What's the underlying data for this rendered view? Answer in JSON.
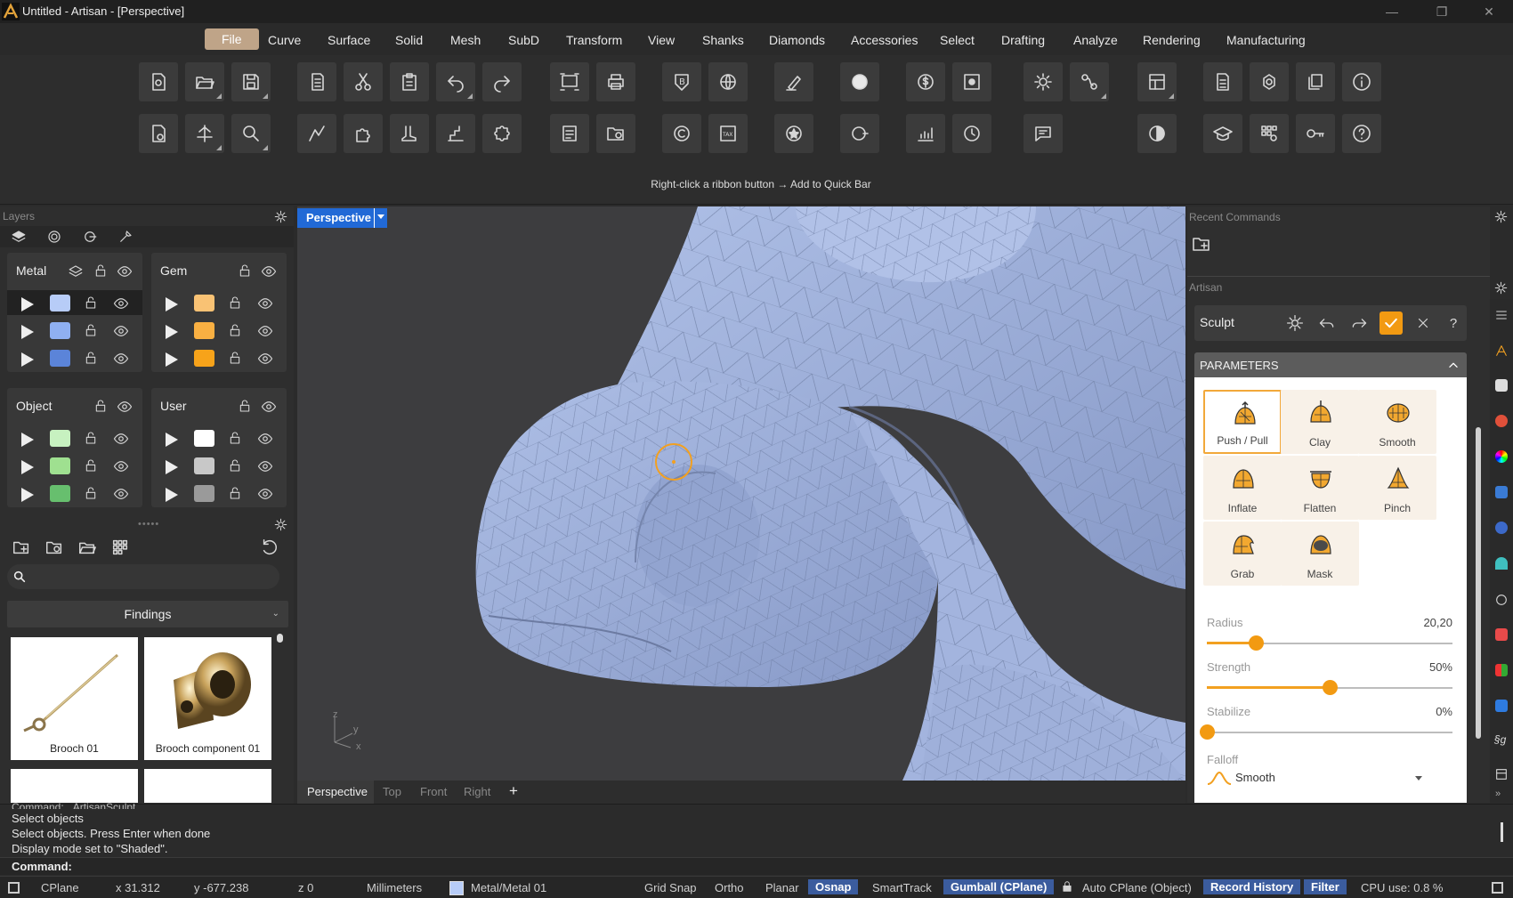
{
  "window": {
    "title": "Untitled - Artisan - [Perspective]",
    "controls": [
      "—",
      "❐",
      "✕"
    ]
  },
  "menu": [
    "File",
    "Curve",
    "Surface",
    "Solid",
    "Mesh",
    "SubD",
    "Transform",
    "View",
    "Shanks",
    "Diamonds",
    "Accessories",
    "Select",
    "Drafting",
    "Analyze",
    "Rendering",
    "Manufacturing"
  ],
  "ribbon": {
    "hint": "Right-click a ribbon button → Add to Quick Bar"
  },
  "layers": {
    "title": "Layers",
    "groups": [
      {
        "name": "Metal",
        "colors": [
          "#b7ccf7",
          "#8fb0f2",
          "#5b84d9"
        ]
      },
      {
        "name": "Gem",
        "colors": [
          "#f9c274",
          "#f9b042",
          "#f7a31a"
        ]
      },
      {
        "name": "Object",
        "colors": [
          "#c7f1c0",
          "#9fe090",
          "#67bf6e"
        ]
      },
      {
        "name": "User",
        "colors": [
          "#ffffff",
          "#c8c8c8",
          "#9a9a9a"
        ]
      }
    ]
  },
  "library": {
    "search_placeholder": "",
    "category": "Findings",
    "items": [
      "Brooch 01",
      "Brooch component 01"
    ]
  },
  "viewport": {
    "active": "Perspective",
    "tabs": [
      "Perspective",
      "Top",
      "Front",
      "Right"
    ],
    "add": "+",
    "axes": {
      "z": "z",
      "y": "y",
      "x": "x"
    }
  },
  "recent": {
    "title": "Recent Commands"
  },
  "artisan": {
    "title": "Artisan",
    "mode": "Sculpt",
    "params_title": "PARAMETERS",
    "tools": [
      "Push / Pull",
      "Clay",
      "Smooth",
      "Inflate",
      "Flatten",
      "Pinch",
      "Grab",
      "Mask"
    ],
    "selected_tool": "Push / Pull",
    "sliders": [
      {
        "label": "Radius",
        "value": "20,20",
        "fraction": 0.2
      },
      {
        "label": "Strength",
        "value": "50%",
        "fraction": 0.5
      },
      {
        "label": "Stabilize",
        "value": "0%",
        "fraction": 0.0
      }
    ],
    "falloff_label": "Falloff",
    "falloff_value": "Smooth"
  },
  "command_log": [
    "Command: _ArtisanSculpt",
    "Select objects",
    "Select objects. Press Enter when done",
    "Display mode set to \"Shaded\"."
  ],
  "command_prompt": "Command:",
  "status": {
    "cplane": "CPlane",
    "x": "x 31.312",
    "y": "y -677.238",
    "z": "z 0",
    "units": "Millimeters",
    "layer": "Metal/Metal 01",
    "layer_color": "#b7ccf7",
    "grid_snap": "Grid Snap",
    "ortho": "Ortho",
    "planar": "Planar",
    "osnap": "Osnap",
    "smarttrack": "SmartTrack",
    "gumball": "Gumball (CPlane)",
    "auto_cplane": "Auto CPlane (Object)",
    "record_history": "Record History",
    "filter": "Filter",
    "cpu": "CPU use: 0.8 %"
  }
}
